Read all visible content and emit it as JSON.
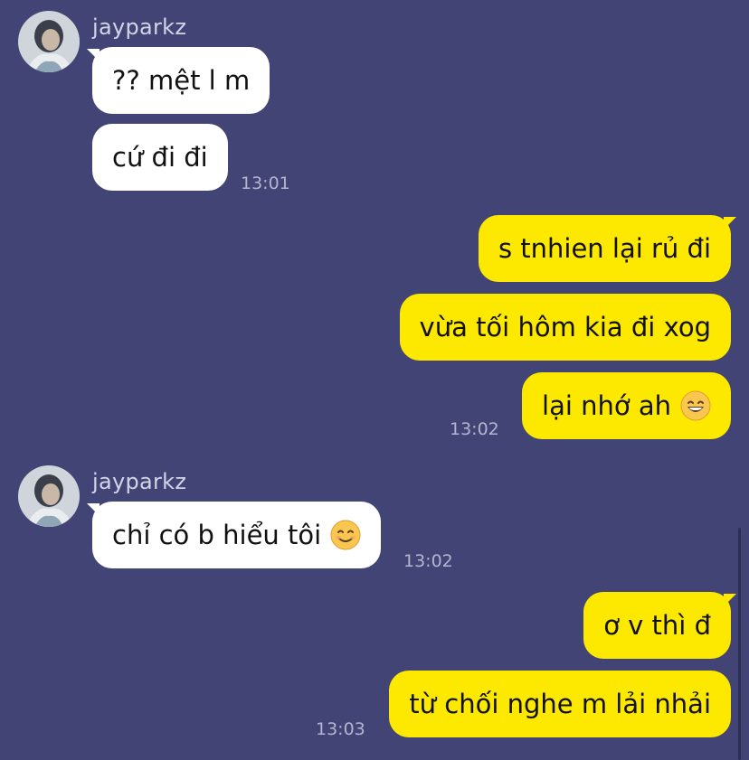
{
  "messages": [
    {
      "side": "in",
      "sender": "jayparkz",
      "text": "?? mệt l m"
    },
    {
      "side": "in",
      "text": "cứ đi đi",
      "time": "13:01"
    },
    {
      "side": "out",
      "text": "s tnhien lại rủ đi"
    },
    {
      "side": "out",
      "text": "vừa tối hôm kia đi xog"
    },
    {
      "side": "out",
      "text": "lại nhớ ah",
      "emoji": "grinning-face-emoji",
      "time": "13:02"
    },
    {
      "side": "in",
      "sender": "jayparkz",
      "text": "chỉ có b hiểu tôi",
      "emoji": "smiling-face-emoji",
      "time": "13:02"
    },
    {
      "side": "out",
      "text": "ơ v thì đ"
    },
    {
      "side": "out",
      "text": "từ chối nghe m lải nhải",
      "time": "13:03"
    }
  ],
  "colors": {
    "background": "#414475",
    "incoming_bubble": "#ffffff",
    "outgoing_bubble": "#fde800",
    "timestamp": "#b3b6cf",
    "sender_name": "#d3d5e6"
  }
}
